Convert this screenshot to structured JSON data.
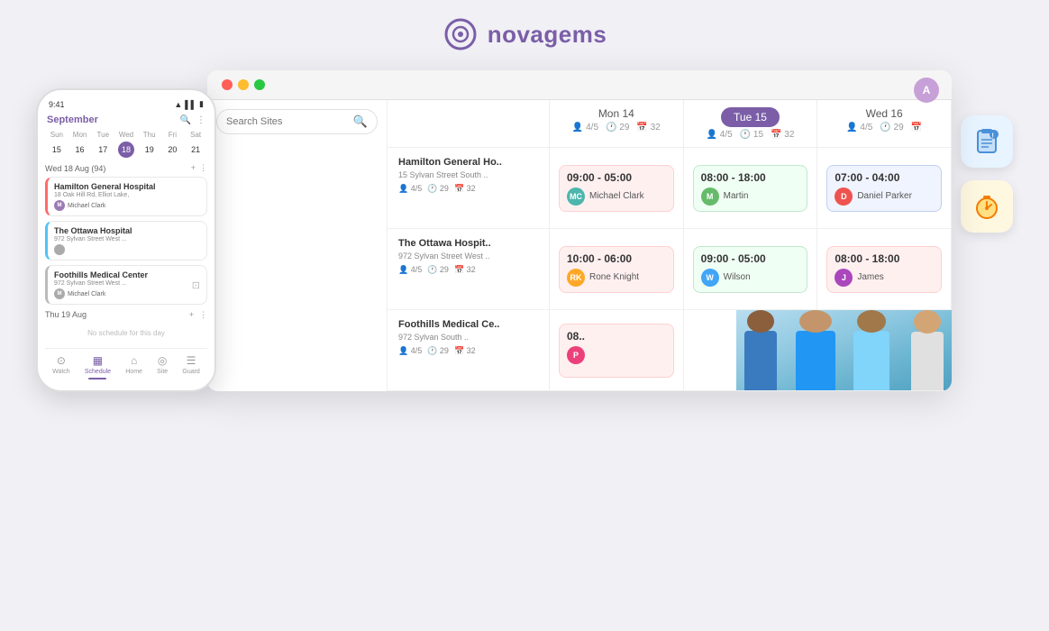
{
  "app": {
    "name": "novagems",
    "logo_alt": "novagems logo"
  },
  "header": {
    "user_avatar_initials": "A"
  },
  "phone": {
    "time": "9:41",
    "month": "September",
    "days_header": [
      "Sun",
      "Mon",
      "Tue",
      "Wed",
      "Thu",
      "Fri",
      "Sat"
    ],
    "week_row": [
      "15",
      "16",
      "17",
      "18",
      "19",
      "20",
      "21"
    ],
    "today_index": 3,
    "section_date": "Wed 18 Aug (94)",
    "cards": [
      {
        "title": "Hamilton General Hospital",
        "address": "18 Oak Hill Rd, Elliot Lake,",
        "person": "Michael Clark",
        "border": "pink"
      },
      {
        "title": "The Ottawa Hospital",
        "address": "972 Sylvan Street West ...",
        "person": "",
        "border": "blue"
      },
      {
        "title": "Foothills Medical Center",
        "address": "972 Sylvan Street West ...",
        "person": "Michael Clark",
        "border": "gray"
      }
    ],
    "thu_section": "Thu 19 Aug",
    "no_schedule": "No schedule for this day",
    "nav_items": [
      {
        "label": "Watch",
        "icon": "⊙",
        "active": false
      },
      {
        "label": "Schedule",
        "icon": "▦",
        "active": true
      },
      {
        "label": "Home",
        "icon": "⌂",
        "active": false
      },
      {
        "label": "Site",
        "icon": "◎",
        "active": false
      },
      {
        "label": "Guard",
        "icon": "☰",
        "active": false
      }
    ]
  },
  "browser": {
    "search_placeholder": "Search Sites",
    "days": [
      {
        "label": "Mon 14",
        "is_today": false,
        "meta_people": "4/5",
        "meta_time": "29",
        "meta_calendar": "32"
      },
      {
        "label": "Tue 15",
        "is_today": true,
        "meta_people": "4/5",
        "meta_time": "15",
        "meta_calendar": "32"
      },
      {
        "label": "Wed 16",
        "is_today": false,
        "meta_people": "4/5",
        "meta_time": "29",
        "meta_calendar": ""
      }
    ],
    "sites": [
      {
        "name": "Hamilton General Ho..",
        "address": "15 Sylvan Street South ..",
        "meta_people": "4/5",
        "meta_time": "29",
        "meta_calendar": "32",
        "shifts": [
          {
            "time": "09:00 - 05:00",
            "person": "Michael Clark",
            "avatar_initials": "MC",
            "avatar_class": "pa-teal",
            "card_class": "pink"
          },
          {
            "time": "08:00 - 18:00",
            "person": "Martin",
            "avatar_initials": "M",
            "avatar_class": "pa-green",
            "card_class": "green"
          },
          {
            "time": "07:00 - 04:00",
            "person": "Daniel Parker",
            "avatar_initials": "D",
            "avatar_class": "pa-red",
            "card_class": "blue"
          }
        ]
      },
      {
        "name": "The Ottawa Hospit..",
        "address": "972 Sylvan Street West ..",
        "meta_people": "4/5",
        "meta_time": "29",
        "meta_calendar": "32",
        "shifts": [
          {
            "time": "10:00 - 06:00",
            "person": "Rone Knight",
            "avatar_initials": "RK",
            "avatar_class": "pa-orange",
            "card_class": "pink"
          },
          {
            "time": "09:00 - 05:00",
            "person": "Wilson",
            "avatar_initials": "W",
            "avatar_class": "pa-blue",
            "card_class": "green"
          },
          {
            "time": "08:00 - 18:00",
            "person": "James",
            "avatar_initials": "J",
            "avatar_class": "pa-purple",
            "card_class": "pink"
          }
        ]
      },
      {
        "name": "Foothills Medical Ce..",
        "address": "972 Sylvan South ..",
        "meta_people": "4/5",
        "meta_time": "29",
        "meta_calendar": "32",
        "shifts": [
          {
            "time": "08..",
            "person": "P",
            "avatar_initials": "P",
            "avatar_class": "pa-pink",
            "card_class": "pink",
            "partial": true
          },
          null,
          null
        ]
      }
    ],
    "right_widgets": [
      {
        "icon": "📋",
        "class": "blue-widget",
        "label": "clipboard-icon"
      },
      {
        "icon": "⏱",
        "class": "yellow-widget",
        "label": "timer-icon"
      }
    ]
  }
}
